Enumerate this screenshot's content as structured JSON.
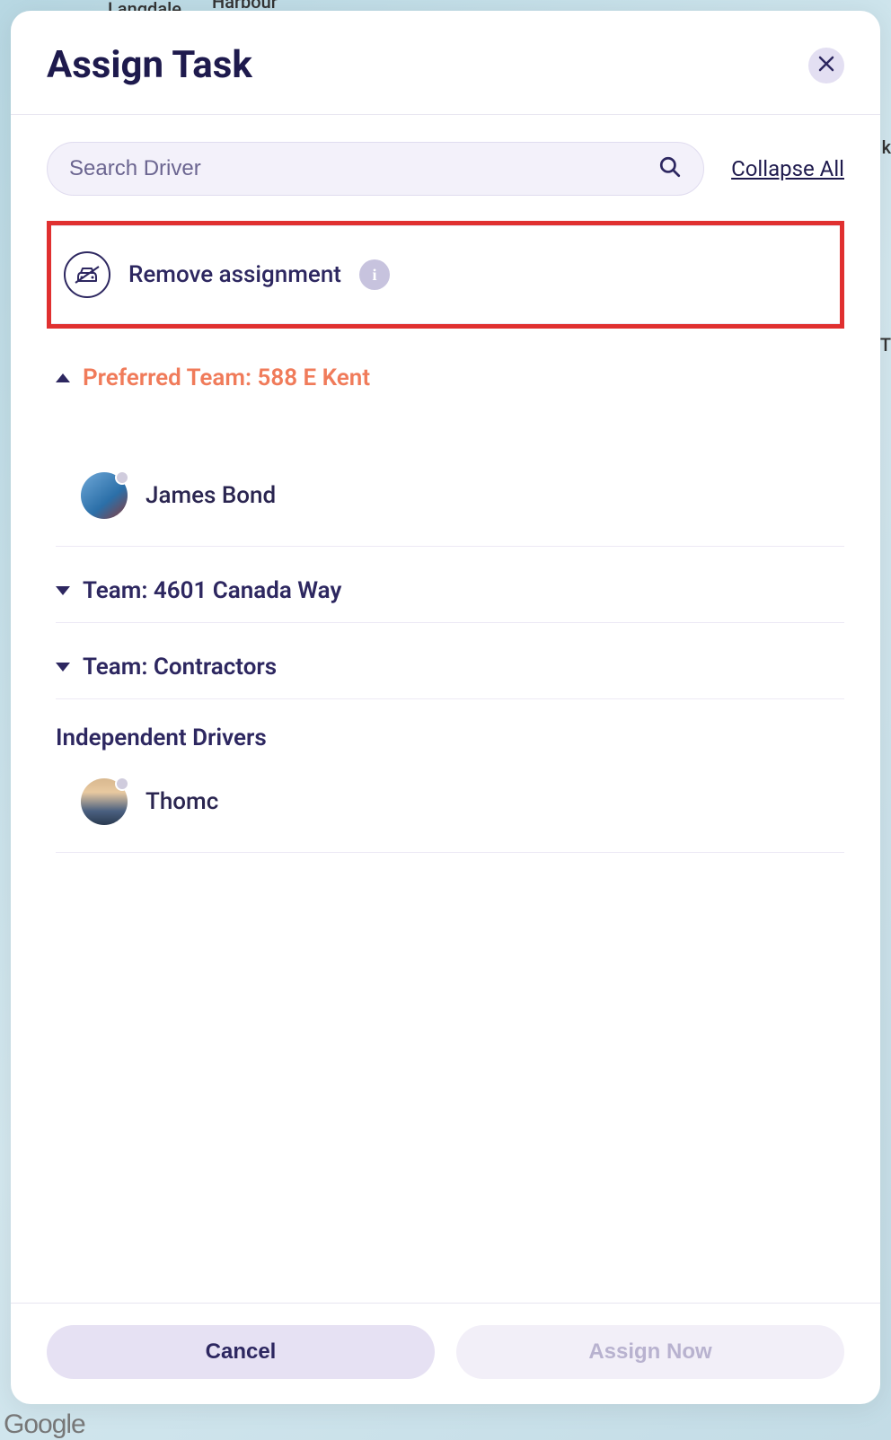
{
  "map": {
    "label1": "Langdale",
    "label2": "Harbour",
    "attribution": "Google",
    "partial_label_right": "k",
    "partial_label_right2": "T"
  },
  "modal": {
    "title": "Assign Task",
    "search_placeholder": "Search Driver",
    "collapse_all": "Collapse All",
    "remove_assignment": "Remove assignment",
    "sections": {
      "preferred": {
        "label": "Preferred Team: 588 E Kent",
        "expanded": true,
        "drivers": [
          {
            "name": "James Bond"
          }
        ]
      },
      "teams": [
        {
          "label": "Team: 4601 Canada Way",
          "expanded": false
        },
        {
          "label": "Team: Contractors",
          "expanded": false
        }
      ],
      "independent": {
        "label": "Independent Drivers",
        "drivers": [
          {
            "name": "Thomc"
          }
        ]
      }
    },
    "footer": {
      "cancel": "Cancel",
      "assign": "Assign Now"
    }
  }
}
